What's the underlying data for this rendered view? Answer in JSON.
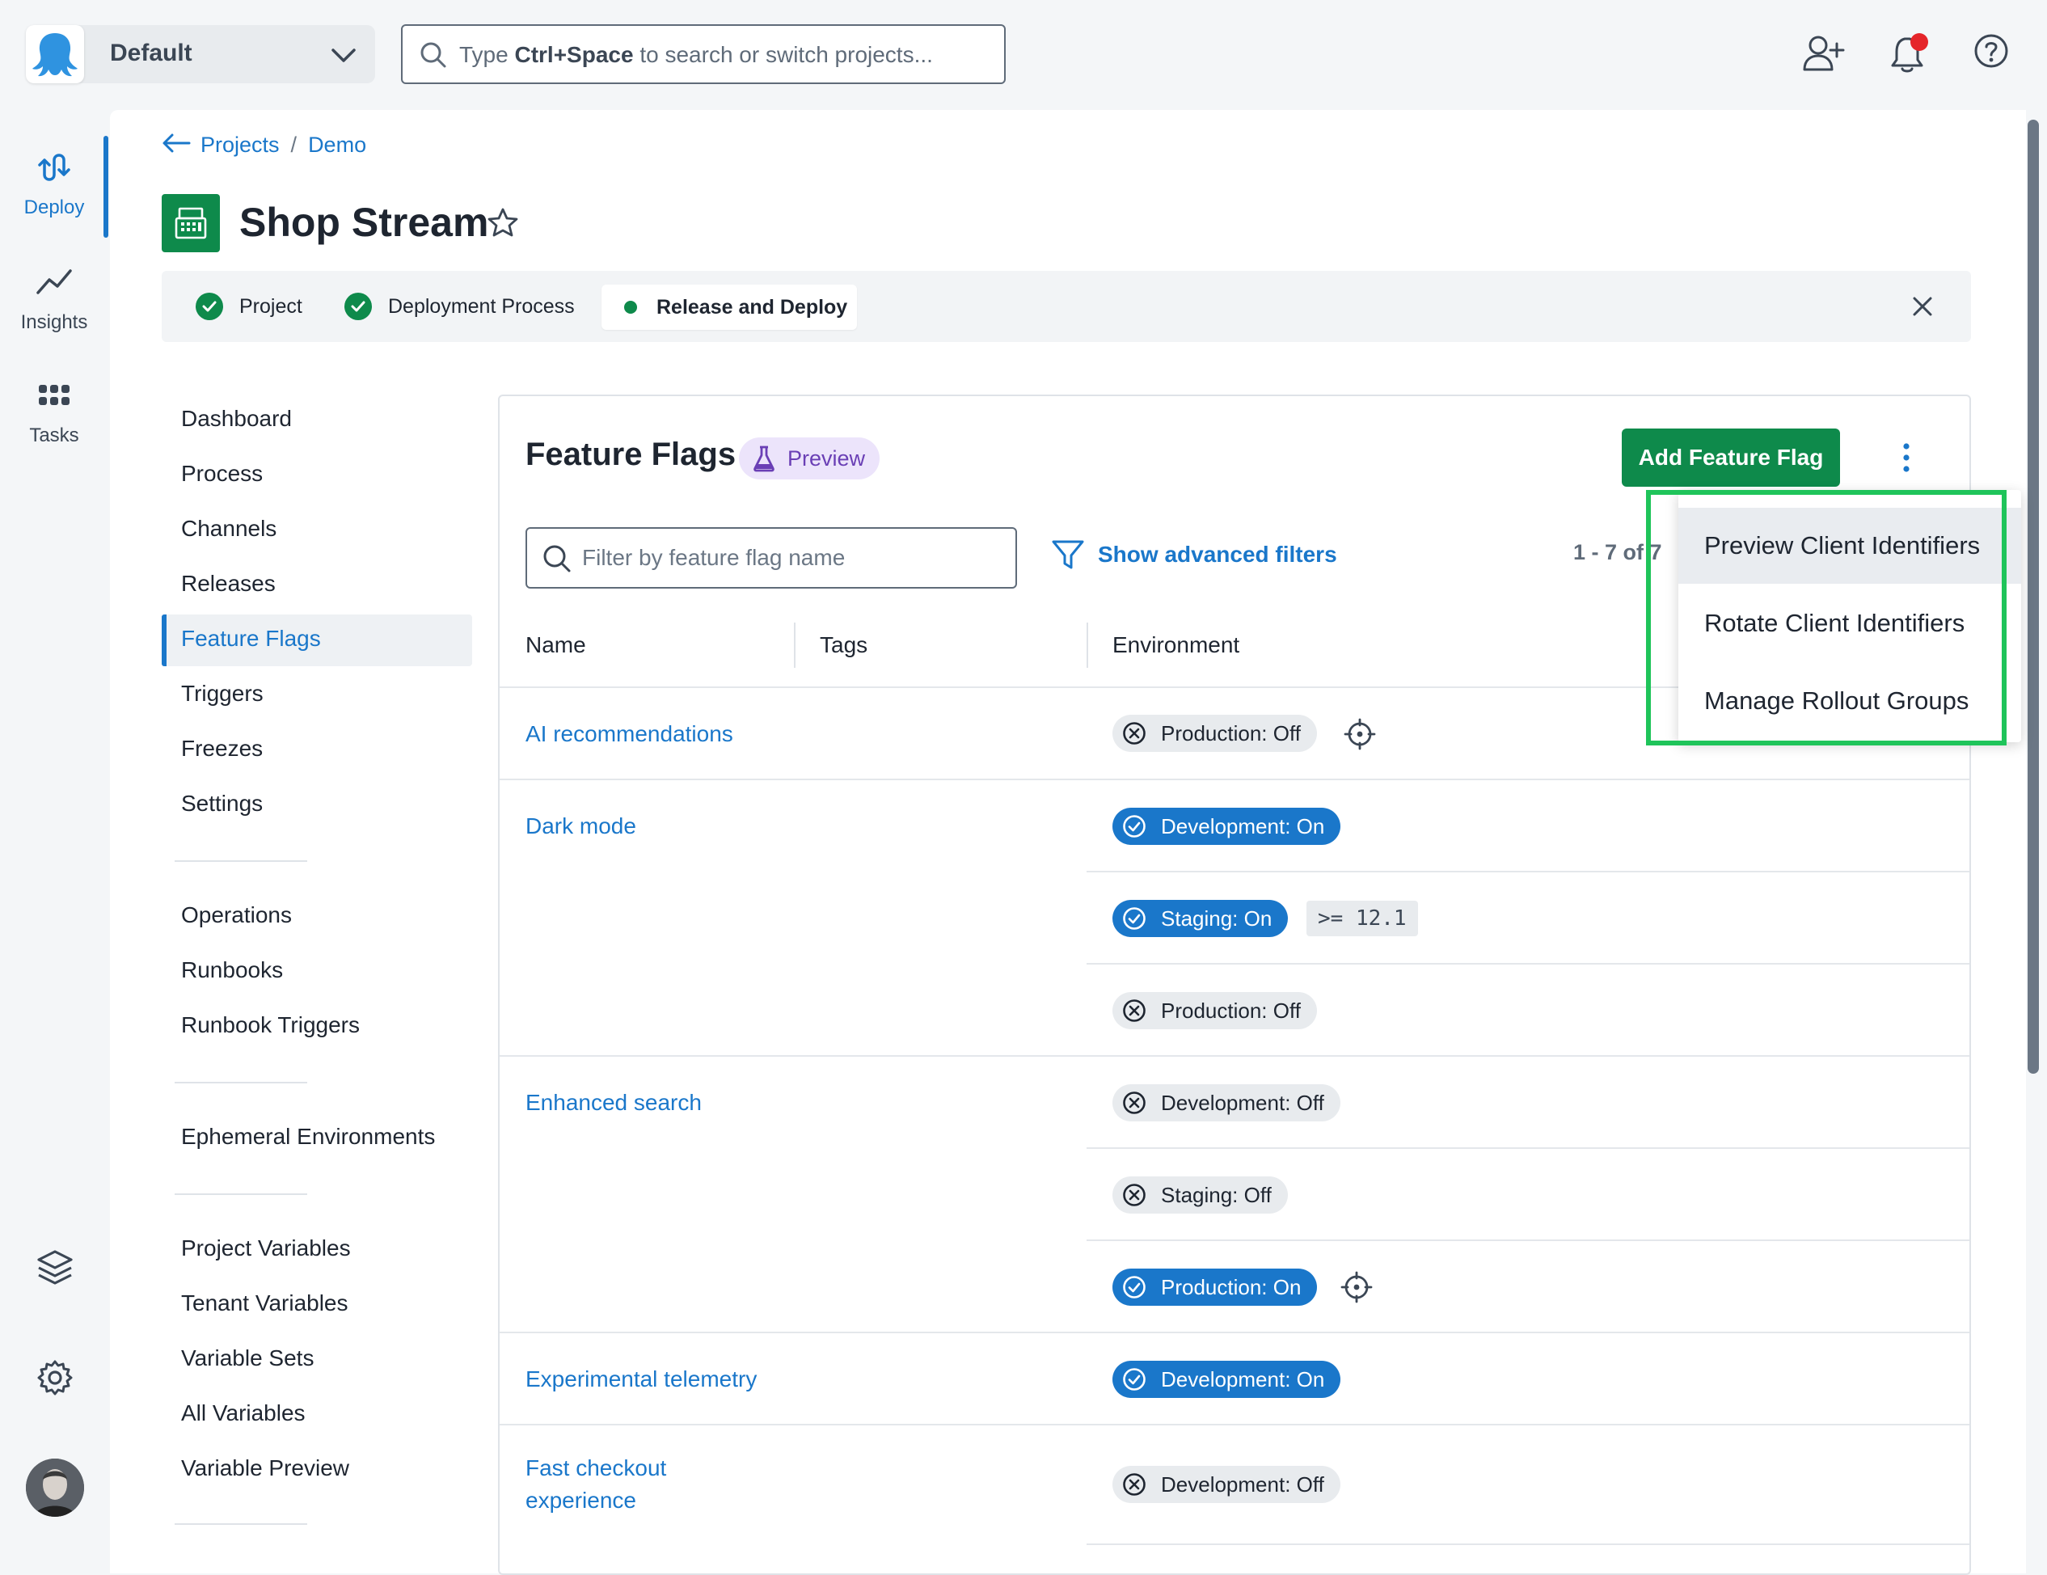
{
  "topbar": {
    "space_name": "Default",
    "search_placeholder_pre": "Type ",
    "search_placeholder_key": "Ctrl+Space",
    "search_placeholder_post": " to search or switch projects..."
  },
  "rail": {
    "items": [
      {
        "label": "Deploy",
        "icon": "deploy-icon"
      },
      {
        "label": "Insights",
        "icon": "insights-icon"
      },
      {
        "label": "Tasks",
        "icon": "tasks-icon"
      }
    ]
  },
  "breadcrumb": {
    "items": [
      "Projects",
      "Demo"
    ],
    "separator": "/"
  },
  "project": {
    "title": "Shop Stream"
  },
  "steps": {
    "items": [
      "Project",
      "Deployment Process",
      "Release and Deploy"
    ]
  },
  "sidenav": {
    "group1": [
      "Dashboard",
      "Process",
      "Channels",
      "Releases",
      "Feature Flags",
      "Triggers",
      "Freezes",
      "Settings"
    ],
    "group2": [
      "Operations",
      "Runbooks",
      "Runbook Triggers"
    ],
    "group3": [
      "Ephemeral Environments"
    ],
    "group4": [
      "Project Variables",
      "Tenant Variables",
      "Variable Sets",
      "All Variables",
      "Variable Preview"
    ]
  },
  "feature_flags": {
    "title": "Feature Flags",
    "badge": "Preview",
    "add_button": "Add Feature Flag",
    "filter_placeholder": "Filter by feature flag name",
    "advanced_filters": "Show advanced filters",
    "pager": "1 - 7 of 7",
    "columns": [
      "Name",
      "Tags",
      "Environment"
    ],
    "rows": [
      {
        "name": "AI recommendations",
        "envs": [
          "Production: Off"
        ]
      },
      {
        "name": "Dark mode",
        "envs": [
          "Development: On",
          "Staging: On",
          "Production: Off"
        ],
        "rule": ">= 12.1"
      },
      {
        "name": "Enhanced search",
        "envs": [
          "Development: Off",
          "Staging: Off",
          "Production: On"
        ]
      },
      {
        "name": "Experimental telemetry",
        "envs": [
          "Development: On"
        ]
      },
      {
        "name_line1": "Fast checkout",
        "name_line2": "experience",
        "envs": [
          "Development: Off"
        ]
      }
    ]
  },
  "menu": {
    "items": [
      "Preview Client Identifiers",
      "Rotate Client Identifiers",
      "Manage Rollout Groups"
    ]
  },
  "colors": {
    "accent_blue": "#1a77ca",
    "brand_green": "#0e8a4b",
    "highlight_green": "#1fc45a",
    "notification_red": "#e5252a"
  }
}
